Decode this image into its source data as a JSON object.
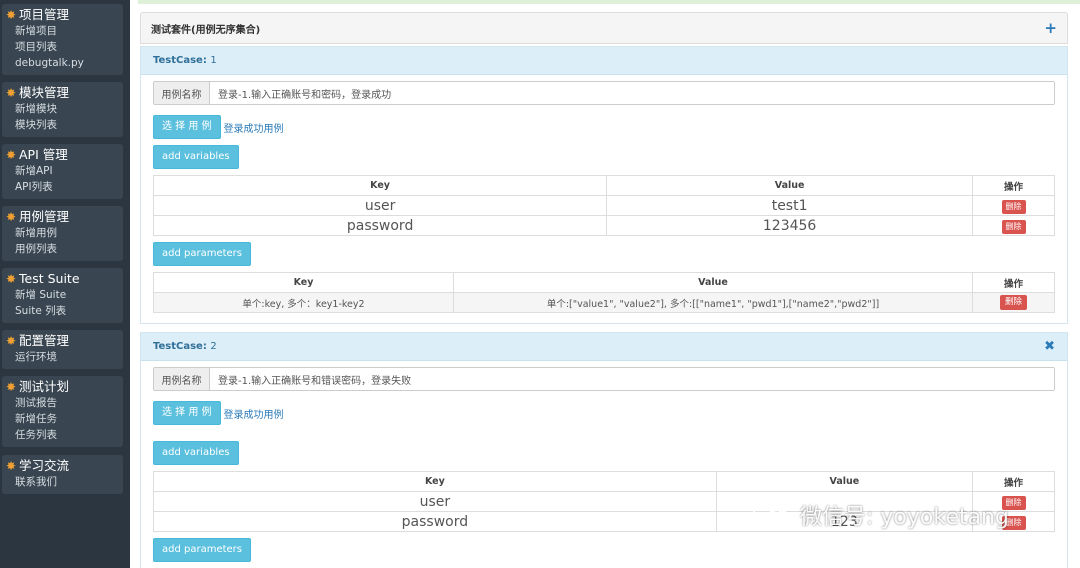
{
  "sidebar": {
    "groups": [
      {
        "title": "项目管理",
        "items": [
          "新增项目",
          "项目列表",
          "debugtalk.py"
        ]
      },
      {
        "title": "模块管理",
        "items": [
          "新增模块",
          "模块列表"
        ]
      },
      {
        "title": "API 管理",
        "items": [
          "新增API",
          "API列表"
        ]
      },
      {
        "title": "用例管理",
        "items": [
          "新增用例",
          "用例列表"
        ]
      },
      {
        "title": "Test Suite",
        "items": [
          "新增 Suite",
          "Suite 列表"
        ]
      },
      {
        "title": "配置管理",
        "items": [
          "运行环境"
        ]
      },
      {
        "title": "测试计划",
        "items": [
          "测试报告",
          "新增任务",
          "任务列表"
        ]
      },
      {
        "title": "学习交流",
        "items": [
          "联系我们"
        ]
      }
    ]
  },
  "suite": {
    "title": "测试套件(用例无序集合)",
    "add_icon": "plus-icon"
  },
  "testcases": [
    {
      "label": "TestCase:",
      "num": "1",
      "name_label": "用例名称",
      "name_value": "登录-1.输入正确账号和密码，登录成功",
      "select_label": "选 择 用 例",
      "select_link": "登录成功用例",
      "add_variables": "add variables",
      "var_headers": {
        "key": "Key",
        "value": "Value",
        "op": "操作"
      },
      "variables": [
        {
          "key": "user",
          "value": "test1",
          "op": "删除"
        },
        {
          "key": "password",
          "value": "123456",
          "op": "删除"
        }
      ],
      "add_parameters": "add parameters",
      "param_headers": {
        "key": "Key",
        "value": "Value",
        "op": "操作"
      },
      "params": [
        {
          "key": "单个:key, 多个：key1-key2",
          "value": "单个:[\"value1\", \"value2\"], 多个:[[\"name1\", \"pwd1\"],[\"name2\",\"pwd2\"]]",
          "op": "删除"
        }
      ]
    },
    {
      "label": "TestCase:",
      "num": "2",
      "name_label": "用例名称",
      "name_value": "登录-1.输入正确账号和错误密码，登录失败",
      "select_label": "选 择 用 例",
      "select_link": "登录成功用例",
      "add_variables": "add variables",
      "var_headers": {
        "key": "Key",
        "value": "Value",
        "op": "操作"
      },
      "variables": [
        {
          "key": "user",
          "value": "",
          "op": "删除"
        },
        {
          "key": "password",
          "value": "123",
          "op": "删除"
        }
      ],
      "add_parameters": "add parameters"
    }
  ],
  "watermark": "微信号: yoyoketang"
}
